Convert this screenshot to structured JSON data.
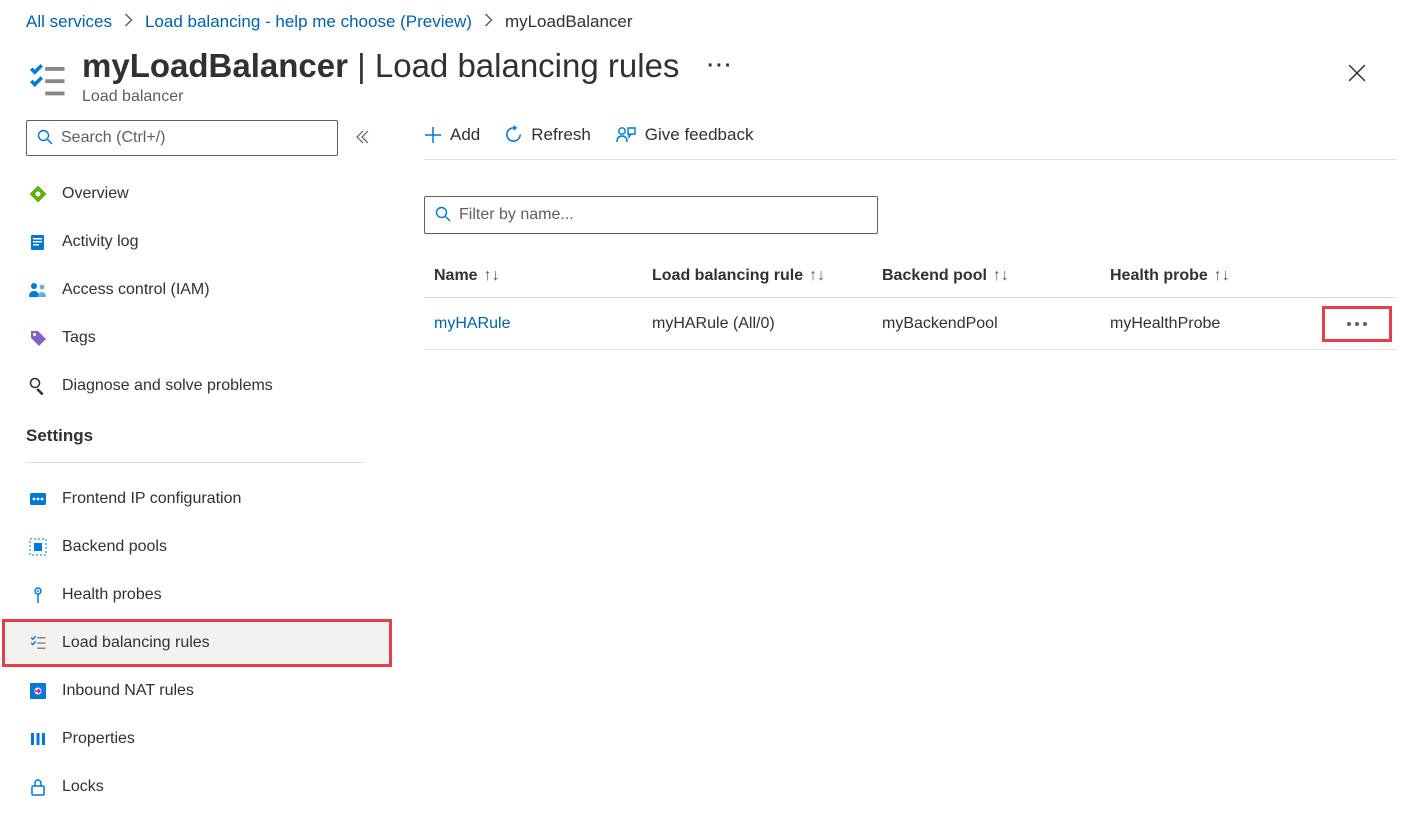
{
  "breadcrumb": {
    "items": [
      {
        "label": "All services",
        "link": true
      },
      {
        "label": "Load balancing - help me choose (Preview)",
        "link": true
      },
      {
        "label": "myLoadBalancer",
        "link": false
      }
    ]
  },
  "header": {
    "resource_name": "myLoadBalancer",
    "title_suffix": "Load balancing rules",
    "subtitle": "Load balancer"
  },
  "sidebar": {
    "search_placeholder": "Search (Ctrl+/)",
    "top_items": [
      {
        "id": "overview",
        "label": "Overview"
      },
      {
        "id": "activity-log",
        "label": "Activity log"
      },
      {
        "id": "access-control",
        "label": "Access control (IAM)"
      },
      {
        "id": "tags",
        "label": "Tags"
      },
      {
        "id": "diagnose",
        "label": "Diagnose and solve problems"
      }
    ],
    "settings_label": "Settings",
    "settings_items": [
      {
        "id": "frontend-ip",
        "label": "Frontend IP configuration"
      },
      {
        "id": "backend-pools",
        "label": "Backend pools"
      },
      {
        "id": "health-probes",
        "label": "Health probes"
      },
      {
        "id": "lb-rules",
        "label": "Load balancing rules",
        "selected": true
      },
      {
        "id": "inbound-nat",
        "label": "Inbound NAT rules"
      },
      {
        "id": "properties",
        "label": "Properties"
      },
      {
        "id": "locks",
        "label": "Locks"
      }
    ]
  },
  "toolbar": {
    "add_label": "Add",
    "refresh_label": "Refresh",
    "feedback_label": "Give feedback"
  },
  "filter": {
    "placeholder": "Filter by name..."
  },
  "table": {
    "columns": {
      "name": "Name",
      "rule": "Load balancing rule",
      "pool": "Backend pool",
      "probe": "Health probe"
    },
    "rows": [
      {
        "name": "myHARule",
        "rule": "myHARule (All/0)",
        "pool": "myBackendPool",
        "probe": "myHealthProbe"
      }
    ]
  },
  "colors": {
    "link": "#0062ad",
    "highlight_border": "#e3404a"
  }
}
